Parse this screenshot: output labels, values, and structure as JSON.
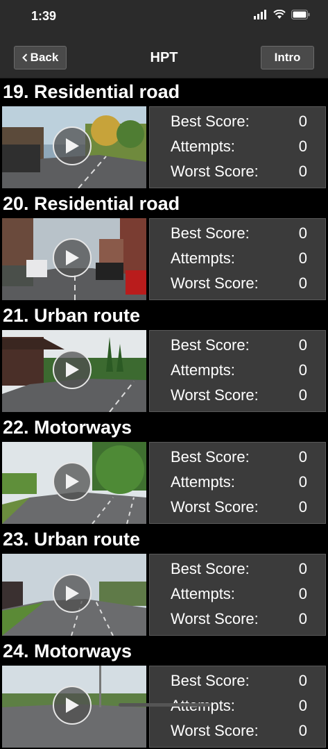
{
  "status_bar": {
    "time": "1:39",
    "icons": [
      "cellular-icon",
      "wifi-icon",
      "battery-icon"
    ]
  },
  "nav": {
    "back_label": "Back",
    "title": "HPT",
    "intro_label": "Intro"
  },
  "stat_labels": {
    "best": "Best Score:",
    "attempts": "Attempts:",
    "worst": "Worst Score:"
  },
  "clips": [
    {
      "title": "19. Residential road",
      "best": "0",
      "attempts": "0",
      "worst": "0",
      "scene": "residential"
    },
    {
      "title": "20. Residential road",
      "best": "0",
      "attempts": "0",
      "worst": "0",
      "scene": "residential2"
    },
    {
      "title": "21. Urban route",
      "best": "0",
      "attempts": "0",
      "worst": "0",
      "scene": "urban"
    },
    {
      "title": "22. Motorways",
      "best": "0",
      "attempts": "0",
      "worst": "0",
      "scene": "motorway"
    },
    {
      "title": "23. Urban route",
      "best": "0",
      "attempts": "0",
      "worst": "0",
      "scene": "urban2"
    },
    {
      "title": "24. Motorways",
      "best": "0",
      "attempts": "0",
      "worst": "0",
      "scene": "motorway2"
    }
  ]
}
